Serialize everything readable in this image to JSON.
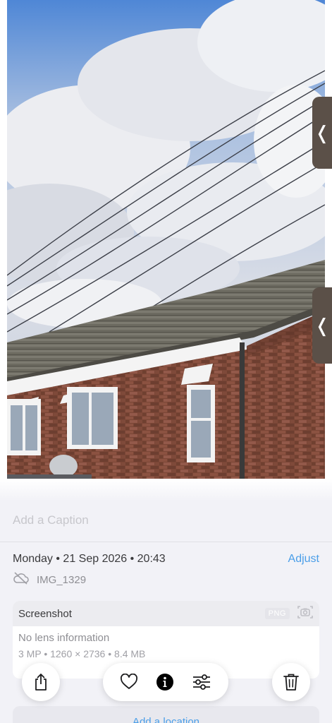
{
  "photo": {
    "description_icon": "photo-of-brick-house-with-power-lines"
  },
  "side_handles": {
    "top_glyph": "❬",
    "mid_glyph": "❬"
  },
  "caption": {
    "placeholder": "Add a Caption"
  },
  "meta": {
    "date": "Monday • 21 Sep 2026 • 20:43",
    "adjust_label": "Adjust",
    "filename": "IMG_1329",
    "cloud_icon": "cloud-slash-icon"
  },
  "card": {
    "title": "Screenshot",
    "format_badge": "PNG",
    "camera_icon": "camera-viewfinder-icon",
    "lens": "No lens information",
    "specs": "3 MP • 1260 × 2736 • 8.4 MB"
  },
  "location": {
    "label": "Add a location"
  },
  "toolbar": {
    "share_icon": "share-icon",
    "favorite_icon": "heart-icon",
    "info_icon": "info-icon",
    "edit_icon": "sliders-icon",
    "delete_icon": "trash-icon"
  },
  "colors": {
    "accent": "#4a9ee8",
    "panel_bg": "#f2f2f7",
    "handle_bg": "#5b5048"
  }
}
